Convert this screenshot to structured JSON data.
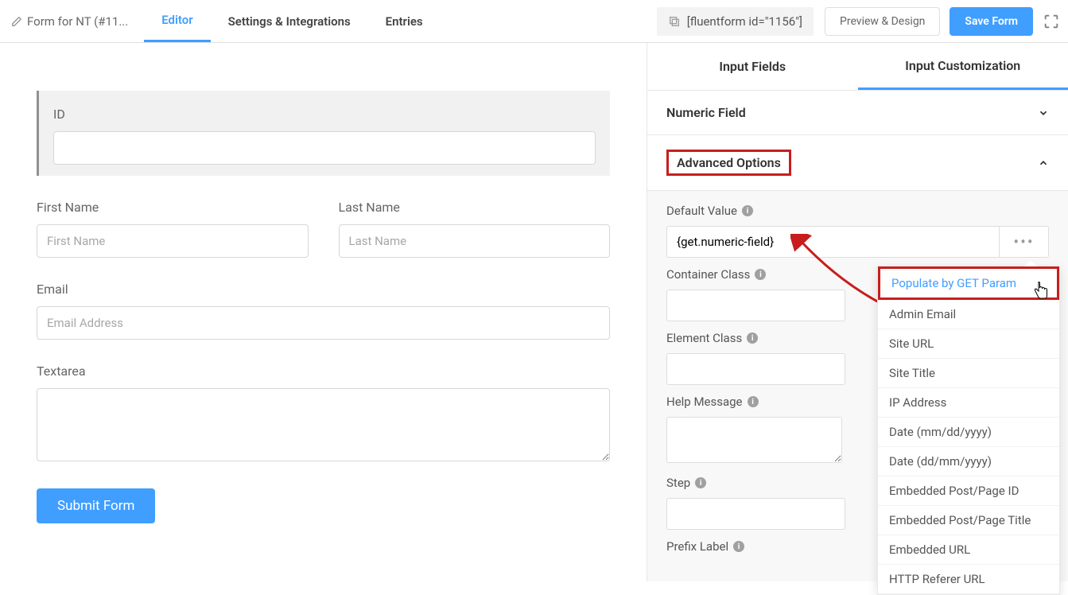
{
  "header": {
    "form_title": "Form for NT (#11...",
    "tabs": {
      "editor": "Editor",
      "settings": "Settings & Integrations",
      "entries": "Entries"
    },
    "shortcode": "[fluentform id=\"1156\"]",
    "preview_btn": "Preview & Design",
    "save_btn": "Save Form"
  },
  "form": {
    "id_label": "ID",
    "first_name_label": "First Name",
    "first_name_placeholder": "First Name",
    "last_name_label": "Last Name",
    "last_name_placeholder": "Last Name",
    "email_label": "Email",
    "email_placeholder": "Email Address",
    "textarea_label": "Textarea",
    "submit_label": "Submit Form"
  },
  "rightpanel": {
    "tabs": {
      "input_fields": "Input Fields",
      "input_customization": "Input Customization"
    },
    "section_numeric": "Numeric Field",
    "section_advanced": "Advanced Options",
    "options": {
      "default_value_label": "Default Value",
      "default_value": "{get.numeric-field}",
      "container_class_label": "Container Class",
      "element_class_label": "Element Class",
      "help_message_label": "Help Message",
      "step_label": "Step",
      "prefix_label_label": "Prefix Label"
    }
  },
  "dropdown": {
    "items": [
      "Populate by GET Param",
      "Admin Email",
      "Site URL",
      "Site Title",
      "IP Address",
      "Date (mm/dd/yyyy)",
      "Date (dd/mm/yyyy)",
      "Embedded Post/Page ID",
      "Embedded Post/Page Title",
      "Embedded URL",
      "HTTP Referer URL"
    ]
  }
}
